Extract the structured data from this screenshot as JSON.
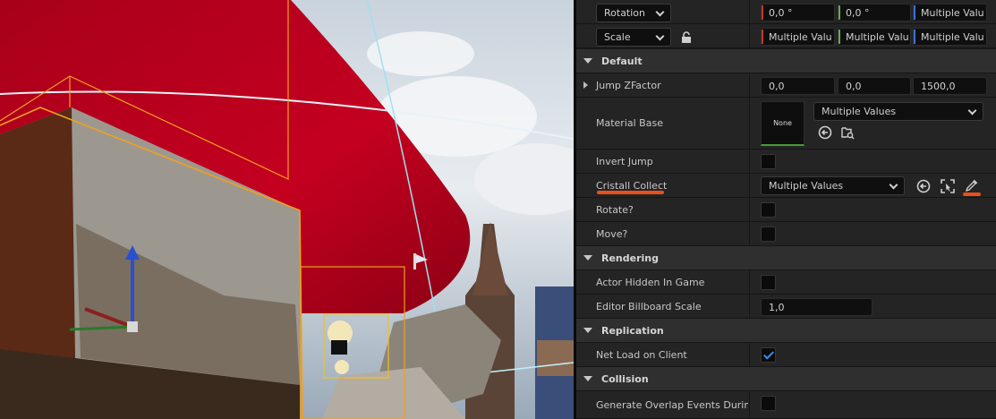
{
  "transform": {
    "rotation": {
      "label": "Rotation",
      "x": "0,0 °",
      "y": "0,0 °",
      "z": "Multiple Valu"
    },
    "scale": {
      "label": "Scale",
      "x": "Multiple Valu",
      "y": "Multiple Valu",
      "z": "Multiple Valu"
    }
  },
  "sections": {
    "default": "Default",
    "rendering": "Rendering",
    "replication": "Replication",
    "collision": "Collision"
  },
  "properties": {
    "jump_zfactor": {
      "label": "Jump ZFactor",
      "x": "0,0",
      "y": "0,0",
      "z": "1500,0"
    },
    "material_base": {
      "label": "Material Base",
      "thumbnail_text": "None",
      "value": "Multiple Values"
    },
    "invert_jump": {
      "label": "Invert Jump",
      "checked": false
    },
    "cristall_collect": {
      "label": "Cristall Collect",
      "value": "Multiple Values"
    },
    "rotate": {
      "label": "Rotate?",
      "checked": false
    },
    "move": {
      "label": "Move?",
      "checked": false
    },
    "actor_hidden": {
      "label": "Actor Hidden In Game",
      "checked": false
    },
    "billboard_scale": {
      "label": "Editor Billboard Scale",
      "value": "1,0"
    },
    "net_load": {
      "label": "Net Load on Client",
      "checked": true
    },
    "overlap_events": {
      "label": "Generate Overlap Events During...",
      "checked": false
    }
  },
  "colors": {
    "axis_x": "#c0392b",
    "axis_y": "#6aa84f",
    "axis_z": "#3d6fd6",
    "annotation": "#e8501a",
    "checkbox_on": "#3d8fe8"
  },
  "icons": {
    "use_selected": "arrow-left-circle-icon",
    "browse": "folder-search-icon",
    "pick_actor": "select-target-icon",
    "eyedropper": "eyedropper-icon",
    "lock": "lock-icon"
  }
}
